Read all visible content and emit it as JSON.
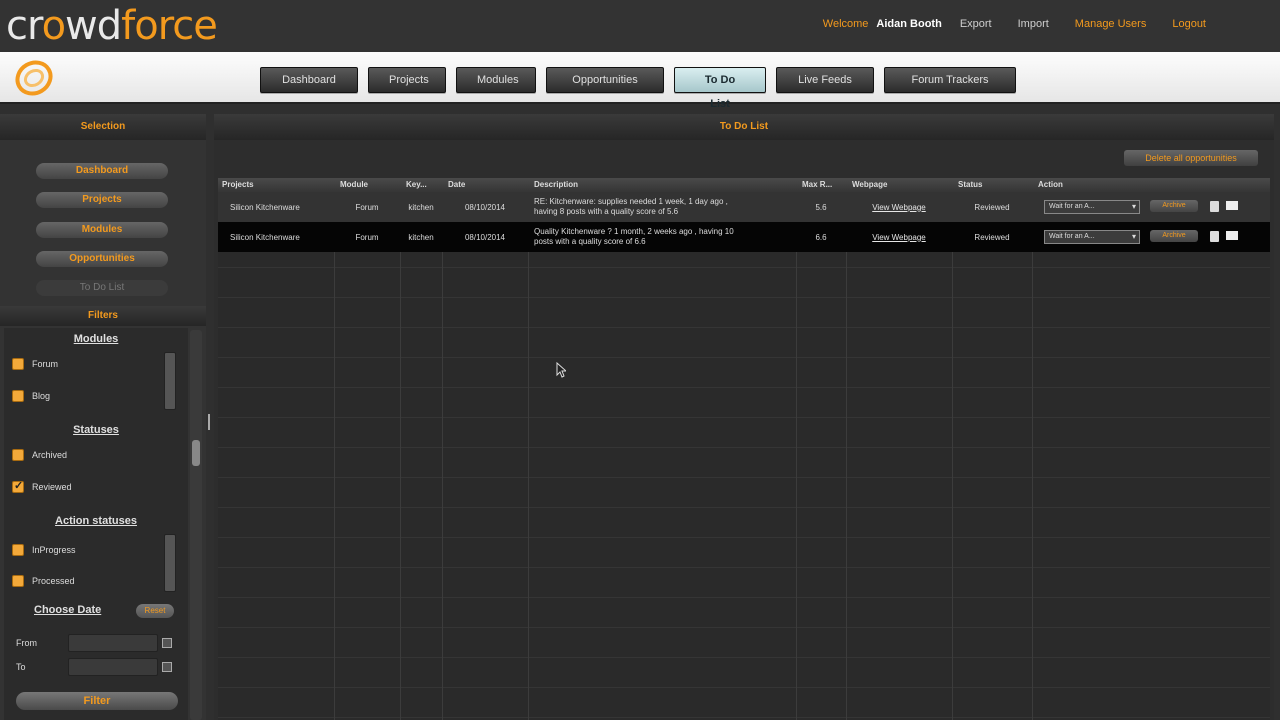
{
  "brand": {
    "logo_pre": "cr",
    "logo_accent": "o",
    "logo_post": "wd",
    "logo_accent2": "force"
  },
  "topnav": {
    "welcome": "Welcome",
    "user": "Aidan Booth",
    "export": "Export",
    "import": "Import",
    "manage_users": "Manage Users",
    "logout": "Logout"
  },
  "nav": {
    "tabs": [
      "Dashboard",
      "Projects",
      "Modules",
      "Opportunities",
      "To Do List",
      "Live Feeds",
      "Forum Trackers"
    ],
    "active": "To Do List"
  },
  "sidebar": {
    "selection_title": "Selection",
    "buttons": [
      "Dashboard",
      "Projects",
      "Modules",
      "Opportunities",
      "To Do List"
    ],
    "filters_title": "Filters",
    "modules": {
      "title": "Modules",
      "items": [
        "Forum",
        "Blog"
      ]
    },
    "statuses": {
      "title": "Statuses",
      "items": [
        "Archived",
        "Reviewed"
      ]
    },
    "action_statuses": {
      "title": "Action statuses",
      "items": [
        "InProgress",
        "Processed"
      ]
    },
    "choose_date": "Choose Date",
    "reset": "Reset",
    "from": "From",
    "to": "To",
    "filter": "Filter"
  },
  "main": {
    "title": "To Do List",
    "delete_all": "Delete all opportunities",
    "columns": [
      "Projects",
      "Module",
      "Key...",
      "Date",
      "Description",
      "Max R...",
      "Webpage",
      "Status",
      "Action"
    ],
    "rows": [
      {
        "project": "Silicon Kitchenware",
        "module": "Forum",
        "key": "kitchen",
        "date": "08/10/2014",
        "desc1": "RE: Kitchenware: supplies needed 1 week, 1 day ago ,",
        "desc2": "having 8 posts with a quality score of 5.6",
        "max": "5.6",
        "webpage": "View Webpage",
        "status": "Reviewed",
        "action": "Wait for an A...",
        "archive": "Archive"
      },
      {
        "project": "Silicon Kitchenware",
        "module": "Forum",
        "key": "kitchen",
        "date": "08/10/2014",
        "desc1": "Quality  Kitchenware ? 1 month, 2 weeks ago , having 10",
        "desc2": "posts with a quality score of 6.6",
        "max": "6.6",
        "webpage": "View Webpage",
        "status": "Reviewed",
        "action": "Wait for an A...",
        "archive": "Archive"
      }
    ]
  },
  "colors": {
    "accent": "#f39a1e",
    "active_tab": "#b9d8dc",
    "background": "#2f2f2f"
  }
}
